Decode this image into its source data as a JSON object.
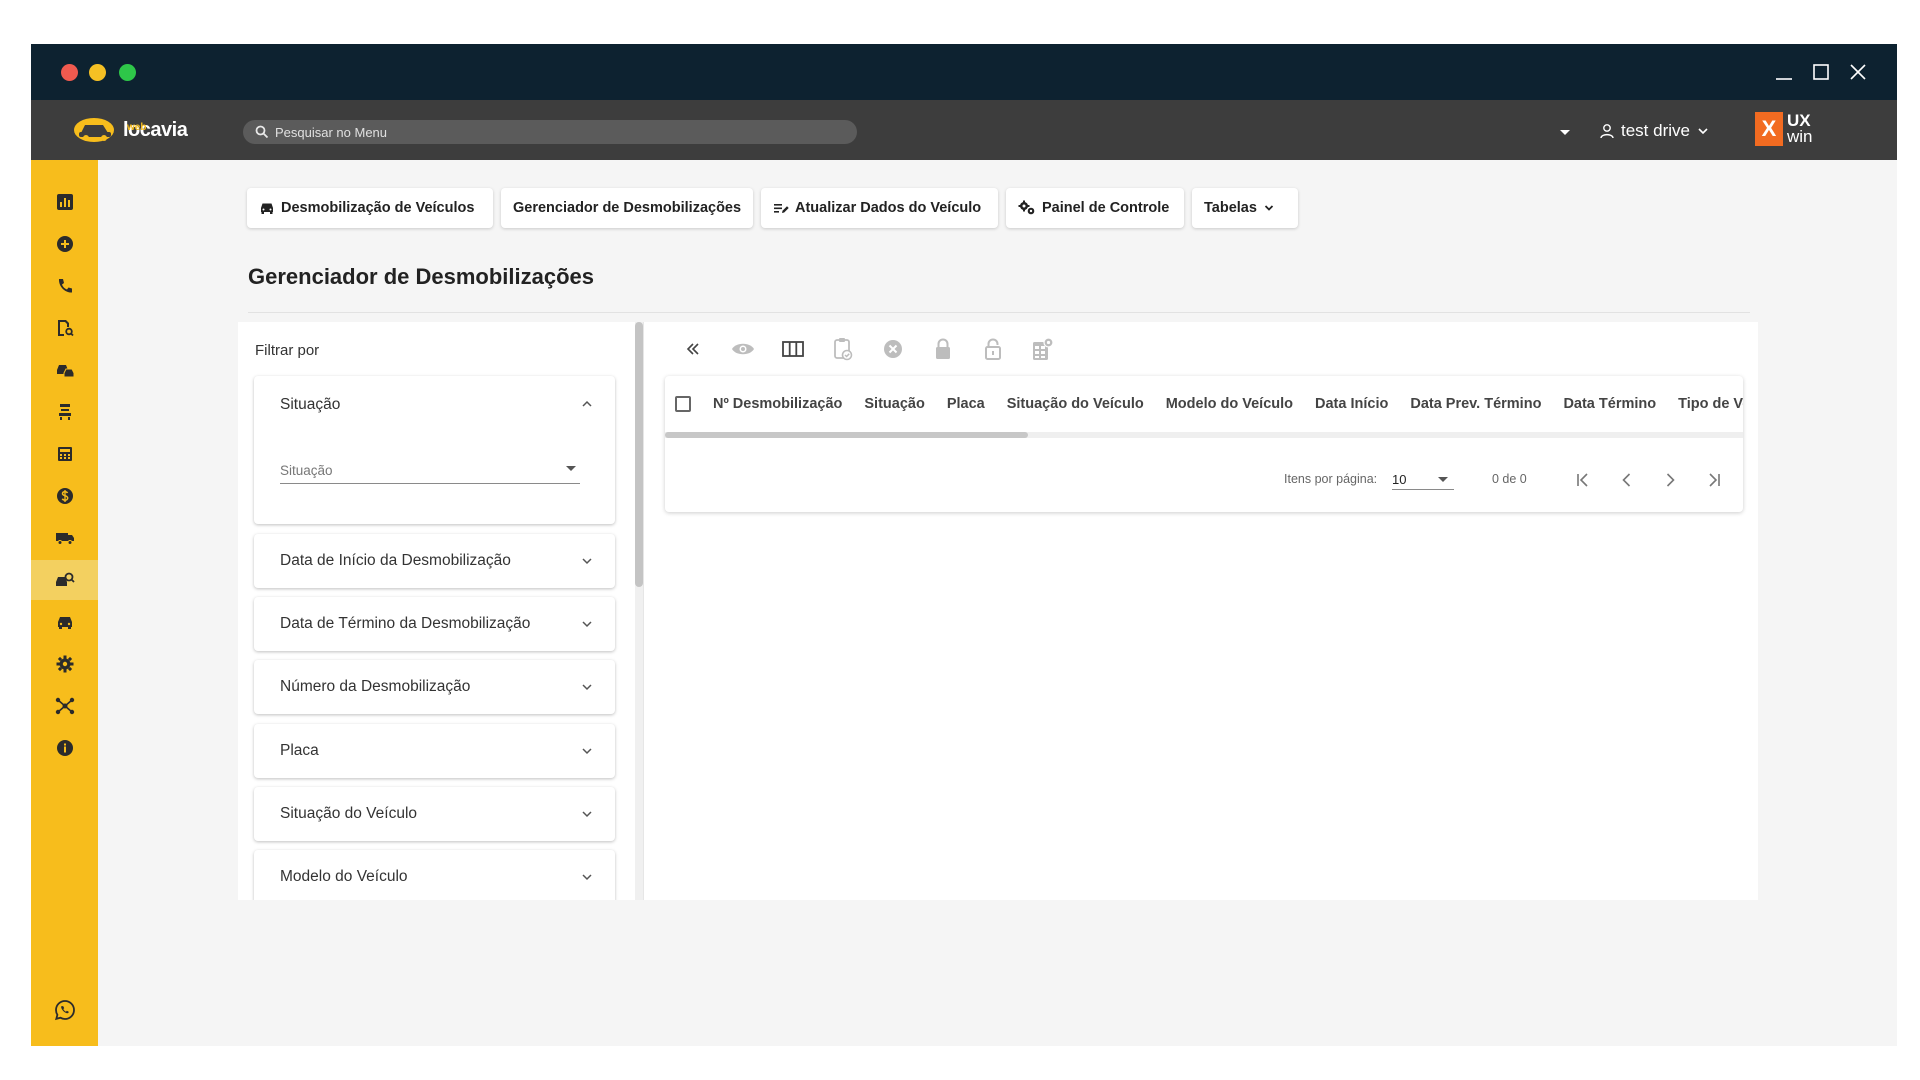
{
  "app": {
    "logo_text": "locavia",
    "logo_sub": "web",
    "search_placeholder": "Pesquisar no Menu",
    "user_name": "test drive",
    "brand_mark": "X",
    "brand_line1": "UX",
    "brand_line2": "win"
  },
  "colors": {
    "titlebar": "#0d2230",
    "appbar": "#3d3d3d",
    "sidebar": "#f7bd1c",
    "brand_orange": "#f26b21"
  },
  "sidebar": {
    "items": [
      {
        "icon": "chart-icon"
      },
      {
        "icon": "add-circle-icon"
      },
      {
        "icon": "phone-icon"
      },
      {
        "icon": "document-search-icon"
      },
      {
        "icon": "car-accident-icon"
      },
      {
        "icon": "seat-icon"
      },
      {
        "icon": "calculator-icon"
      },
      {
        "icon": "dollar-icon"
      },
      {
        "icon": "truck-icon"
      },
      {
        "icon": "car-search-icon",
        "active": true
      },
      {
        "icon": "car-icon"
      },
      {
        "icon": "gear-icon"
      },
      {
        "icon": "network-icon"
      },
      {
        "icon": "info-icon"
      }
    ],
    "bottom_icon": "whatsapp-icon"
  },
  "tabs": [
    {
      "label": "Desmobilização de Veículos",
      "icon": "car-icon"
    },
    {
      "label": "Gerenciador de Desmobilizações"
    },
    {
      "label": "Atualizar Dados do Veículo",
      "icon": "edit-list-icon"
    },
    {
      "label": "Painel de Controle",
      "icon": "gears-icon"
    },
    {
      "label": "Tabelas",
      "icon": "chevron-down-icon"
    }
  ],
  "page": {
    "title": "Gerenciador de Desmobilizações"
  },
  "filters": {
    "title": "Filtrar por",
    "open_section": {
      "label": "Situação",
      "select_placeholder": "Situação"
    },
    "sections": [
      "Data de Início da Desmobilização",
      "Data de Término da Desmobilização",
      "Número da Desmobilização",
      "Placa",
      "Situação do Veículo",
      "Modelo do Veículo"
    ]
  },
  "toolbar": {
    "icons": [
      "double-chevron-left-icon",
      "eye-icon",
      "columns-icon",
      "clipboard-check-icon",
      "cancel-circle-icon",
      "lock-icon",
      "unlock-icon",
      "spreadsheet-settings-icon"
    ]
  },
  "grid": {
    "columns": [
      "Nº Desmobilização",
      "Situação",
      "Placa",
      "Situação do Veículo",
      "Modelo do Veículo",
      "Data Início",
      "Data Prev. Término",
      "Data Término",
      "Tipo de Ve"
    ],
    "pager": {
      "items_per_page_label": "Itens por página:",
      "items_per_page": "10",
      "range": "0 de 0"
    }
  }
}
